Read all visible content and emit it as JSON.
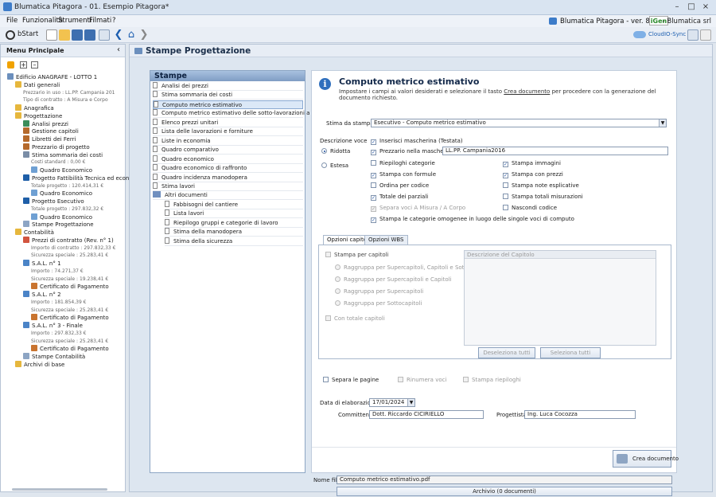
{
  "window": {
    "title": "Blumatica Pitagora - 01. Esempio Pitagora*"
  },
  "menubar": {
    "items": [
      "File",
      "Funzionalità",
      "Strumenti",
      "Filmati",
      "?"
    ],
    "version": "Blumatica Pitagora - ver. 8.0.0.0",
    "brand": "iGen",
    "company": "- Blumatica srl"
  },
  "toolbar": {
    "bstart_label": "bStart",
    "cloud_label": "CloudIO-Sync"
  },
  "left_panel": {
    "title": "Menu Principale",
    "tree": [
      {
        "text": "Edificio ANAGRAFE - LOTTO 1",
        "indent": 0,
        "icon": "building-icon"
      },
      {
        "text": "Dati generali",
        "indent": 1,
        "icon": "folder-icon"
      },
      {
        "text": "Prezzario in uso : LL.PP. Campania 201",
        "indent": 2,
        "dim": true
      },
      {
        "text": "Tipo di contratto : A Misura e Corpo",
        "indent": 2,
        "dim": true
      },
      {
        "text": "Anagrafica",
        "indent": 1,
        "icon": "folder-icon"
      },
      {
        "text": "Progettazione",
        "indent": 1,
        "icon": "folder-icon"
      },
      {
        "text": "Analisi prezzi",
        "indent": 2,
        "icon": "grid-icon"
      },
      {
        "text": "Gestione capitoli",
        "indent": 2,
        "icon": "book-icon"
      },
      {
        "text": "Libretti dei Ferri",
        "indent": 2,
        "icon": "book-icon"
      },
      {
        "text": "Prezzario di progetto",
        "indent": 2,
        "icon": "book-icon"
      },
      {
        "text": "Stima sommaria dei costi",
        "indent": 2,
        "icon": "doc-icon"
      },
      {
        "text": "Costi standard : 0,00 €",
        "indent": 3,
        "dim": true
      },
      {
        "text": "Quadro Economico",
        "indent": 3,
        "icon": "clock-icon"
      },
      {
        "text": "Progetto Fattibilità Tecnica ed econo",
        "indent": 2,
        "icon": "n-icon"
      },
      {
        "text": "Totale progetto : 120.414,31 €",
        "indent": 3,
        "dim": true
      },
      {
        "text": "Quadro Economico",
        "indent": 3,
        "icon": "clock-icon"
      },
      {
        "text": "Progetto Esecutivo",
        "indent": 2,
        "icon": "n-icon"
      },
      {
        "text": "Totale progetto : 297.832,32 €",
        "indent": 3,
        "dim": true
      },
      {
        "text": "Quadro Economico",
        "indent": 3,
        "icon": "clock-icon"
      },
      {
        "text": "Stampe Progettazione",
        "indent": 2,
        "icon": "print-icon"
      },
      {
        "text": "Contabilità",
        "indent": 1,
        "icon": "folder-icon"
      },
      {
        "text": "Prezzi di contratto (Rev. n° 1)",
        "indent": 2,
        "icon": "price-icon"
      },
      {
        "text": "Importo di contratto : 297.832,33 €",
        "indent": 3,
        "dim": true
      },
      {
        "text": "Sicurezza speciale : 25.283,41 €",
        "indent": 3,
        "dim": true
      },
      {
        "text": "S.A.L. n° 1",
        "indent": 2,
        "icon": "chart-icon"
      },
      {
        "text": "Importo : 74.271,37 €",
        "indent": 3,
        "dim": true
      },
      {
        "text": "Sicurezza speciale : 19.238,41 €",
        "indent": 3,
        "dim": true
      },
      {
        "text": "Certificato di Pagamento",
        "indent": 3,
        "icon": "cert-icon"
      },
      {
        "text": "S.A.L. n° 2",
        "indent": 2,
        "icon": "chart-icon"
      },
      {
        "text": "Importo : 181.854,39 €",
        "indent": 3,
        "dim": true
      },
      {
        "text": "Sicurezza speciale : 25.283,41 €",
        "indent": 3,
        "dim": true
      },
      {
        "text": "Certificato di Pagamento",
        "indent": 3,
        "icon": "cert-icon"
      },
      {
        "text": "S.A.L. n° 3 - Finale",
        "indent": 2,
        "icon": "chart-icon"
      },
      {
        "text": "Importo : 297.832,33 €",
        "indent": 3,
        "dim": true
      },
      {
        "text": "Sicurezza speciale : 25.283,41 €",
        "indent": 3,
        "dim": true
      },
      {
        "text": "Certificato di Pagamento",
        "indent": 3,
        "icon": "cert-icon"
      },
      {
        "text": "Stampe Contabilità",
        "indent": 2,
        "icon": "print-icon"
      },
      {
        "text": "Archivi di base",
        "indent": 1,
        "icon": "folder-icon"
      }
    ]
  },
  "main": {
    "title": "Stampe Progettazione",
    "stampe": {
      "title": "Stampe",
      "items": [
        "Analisi dei prezzi",
        "Stima sommaria dei costi",
        "Computo metrico estimativo",
        "Computo metrico estimativo delle sotto-lavorazioni a corpo",
        "Elenco prezzi unitari",
        "Lista delle lavorazioni e forniture",
        "Liste in economia",
        "Quadro comparativo",
        "Quadro economico",
        "Quadro economico di raffronto",
        "Quadro incidenza manodopera",
        "Stima lavori",
        "Altri documenti",
        "Fabbisogni del cantiere",
        "Lista lavori",
        "Riepilogo gruppi e categorie di lavoro",
        "Stima della manodopera",
        "Stima della sicurezza"
      ],
      "selected_index": 2
    },
    "content": {
      "title": "Computo metrico estimativo",
      "desc_pre": "Impostare i campi ai valori desiderati e selezionare il tasto ",
      "desc_link": "Crea documento",
      "desc_post": " per procedere con la generazione del documento richiesto.",
      "stima_label": "Stima da stampare",
      "stima_value": "Esecutivo - Computo metrico estimativo",
      "descr_voce_label": "Descrizione voce",
      "radio_ridotta": "Ridotta",
      "radio_estesa": "Estesa",
      "cb_mascherina": "Inserisci mascherina (Testata)",
      "cb_prezzario": "Prezzario nella mascherina",
      "prezzario_value": "LL.PP. Campania2016",
      "cb_riepiloghi": "Riepiloghi categorie",
      "cb_stampa_immagini": "Stampa immagini",
      "cb_stampa_formule": "Stampa con formule",
      "cb_stampa_prezzi": "Stampa con prezzi",
      "cb_ordina_codice": "Ordina per codice",
      "cb_note": "Stampa note esplicative",
      "cb_totale_parziali": "Totale dei parziali",
      "cb_totali_misurazioni": "Stampa totali misurazioni",
      "cb_separa_voci": "Separa voci A Misura / A Corpo",
      "cb_nascondi": "Nascondi codice",
      "cb_omogenee": "Stampa le categorie omogenee in luogo delle singole voci di computo",
      "tab_capitoli": "Opzioni capitoli",
      "tab_wbs": "Opzioni WBS",
      "cb_stampa_capitoli": "Stampa per capitoli",
      "radio_rag1": "Raggruppa per Supercapitoli, Capitoli e Sottocapitoli",
      "radio_rag2": "Raggruppa per Supercapitoli e Capitoli",
      "radio_rag3": "Raggruppa per Supercapitoli",
      "radio_rag4": "Raggruppa per Sottocapitoli",
      "cb_totale_capitoli": "Con totale capitoli",
      "capitolo_header": "Descrizione del Capitolo",
      "btn_deseleziona": "Deseleziona tutti",
      "btn_seleziona": "Seleziona tutti",
      "cb_separa_pagine": "Separa le pagine",
      "cb_rinumera": "Rinumera voci",
      "cb_riepiloghi2": "Stampa riepiloghi",
      "data_label": "Data di elaborazione",
      "data_value": "17/01/2024",
      "committente_label": "Committente",
      "committente_value": "Dott. Riccardo CICIRIELLO",
      "progettista_label": "Progettista",
      "progettista_value": "Ing. Luca Cocozza",
      "crea_label": "Crea documento",
      "nome_file_label": "Nome file",
      "nome_file_value": "Computo metrico estimativo.pdf",
      "archivio_label": "Archivio (0 documenti)"
    }
  },
  "colors": {
    "accent": "#2f6fbd",
    "selection": "#dbe8f7",
    "panel_header": "#a8c1df"
  }
}
